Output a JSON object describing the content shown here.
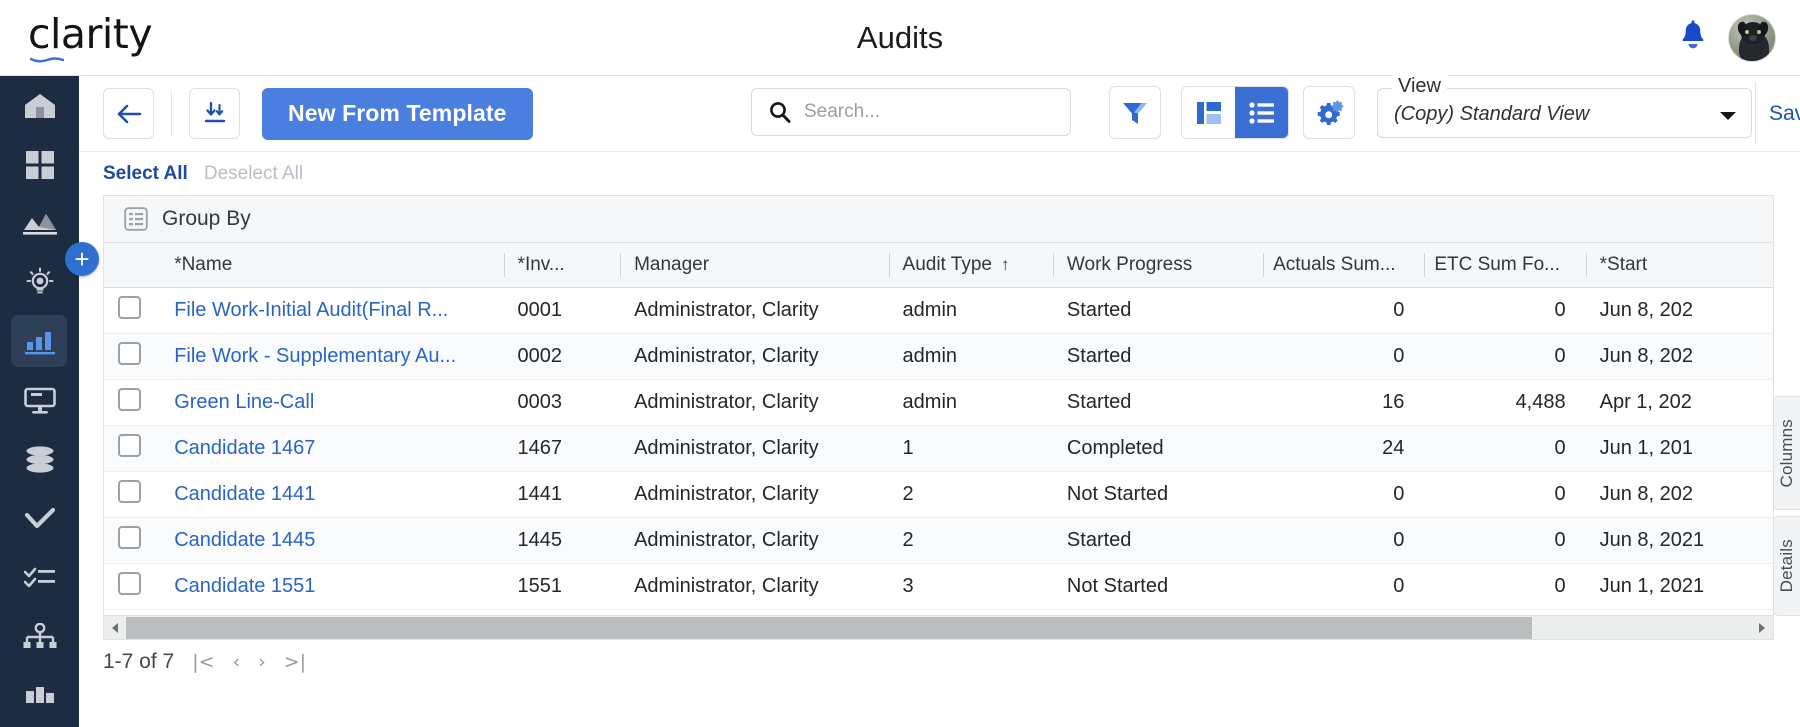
{
  "brand": {
    "name": "clarity"
  },
  "header": {
    "title": "Audits",
    "bell_icon": "notification-bell-icon",
    "avatar_alt": "user-avatar"
  },
  "sidebar": {
    "items": [
      {
        "name": "home",
        "icon": "home-icon",
        "active": false
      },
      {
        "name": "dashboards",
        "icon": "grid-dashboard-icon",
        "active": false
      },
      {
        "name": "analytics",
        "icon": "area-chart-icon",
        "active": false
      },
      {
        "name": "ideas",
        "icon": "lightbulb-icon",
        "active": false
      },
      {
        "name": "reports",
        "icon": "bar-chart-icon",
        "active": true
      },
      {
        "name": "monitor",
        "icon": "monitor-icon",
        "active": false
      },
      {
        "name": "data",
        "icon": "database-icon",
        "active": false
      },
      {
        "name": "approvals",
        "icon": "check-icon",
        "active": false
      },
      {
        "name": "tasks",
        "icon": "checklist-icon",
        "active": false
      },
      {
        "name": "hierarchy",
        "icon": "org-chart-icon",
        "active": false
      },
      {
        "name": "more",
        "icon": "modules-icon",
        "active": false
      }
    ]
  },
  "toolbar": {
    "back_icon": "arrow-left-icon",
    "download_icon": "download-icon",
    "new_from_template_label": "New From Template",
    "search": {
      "value": "",
      "placeholder": "Search..."
    },
    "search_icon": "search-icon",
    "filter_icon": "filter-funnel-icon",
    "board_view_icon": "board-view-icon",
    "list_view_icon": "list-view-icon",
    "list_view_selected": true,
    "settings_icon": "gear-settings-icon",
    "view_label": "View",
    "view_value": "(Copy) Standard View",
    "view_caret_icon": "chevron-down-icon",
    "save_label": "Save"
  },
  "selection": {
    "select_all_label": "Select All",
    "deselect_all_label": "Deselect All"
  },
  "grid": {
    "group_by_label": "Group By",
    "group_by_icon": "group-by-list-icon",
    "add_button_label": "+",
    "columns": [
      {
        "key": "checkbox",
        "label": ""
      },
      {
        "key": "name",
        "label": "*Name"
      },
      {
        "key": "inv",
        "label": "*Inv..."
      },
      {
        "key": "manager",
        "label": "Manager"
      },
      {
        "key": "audit_type",
        "label": "Audit Type",
        "sort": "↑"
      },
      {
        "key": "work_progress",
        "label": "Work Progress"
      },
      {
        "key": "actuals_sum",
        "label": "Actuals Sum..."
      },
      {
        "key": "etc_sum",
        "label": "ETC Sum Fo..."
      },
      {
        "key": "start",
        "label": "*Start"
      }
    ],
    "rows": [
      {
        "name": "File Work-Initial Audit(Final R...",
        "inv": "0001",
        "manager": "Administrator, Clarity",
        "audit_type": "admin",
        "work_progress": "Started",
        "actuals_sum": "0",
        "etc_sum": "0",
        "start": "Jun 8, 202"
      },
      {
        "name": "File Work - Supplementary Au...",
        "inv": "0002",
        "manager": "Administrator, Clarity",
        "audit_type": "admin",
        "work_progress": "Started",
        "actuals_sum": "0",
        "etc_sum": "0",
        "start": "Jun 8, 202"
      },
      {
        "name": "Green Line-Call",
        "inv": "0003",
        "manager": "Administrator, Clarity",
        "audit_type": "admin",
        "work_progress": "Started",
        "actuals_sum": "16",
        "etc_sum": "4,488",
        "start": "Apr 1, 202"
      },
      {
        "name": "Candidate 1467",
        "inv": "1467",
        "manager": "Administrator, Clarity",
        "audit_type": "1",
        "work_progress": "Completed",
        "actuals_sum": "24",
        "etc_sum": "0",
        "start": "Jun 1, 201"
      },
      {
        "name": "Candidate 1441",
        "inv": "1441",
        "manager": "Administrator, Clarity",
        "audit_type": "2",
        "work_progress": "Not Started",
        "actuals_sum": "0",
        "etc_sum": "0",
        "start": "Jun 8, 202"
      },
      {
        "name": "Candidate 1445",
        "inv": "1445",
        "manager": "Administrator, Clarity",
        "audit_type": "2",
        "work_progress": "Started",
        "actuals_sum": "0",
        "etc_sum": "0",
        "start": "Jun 8, 2021"
      },
      {
        "name": "Candidate 1551",
        "inv": "1551",
        "manager": "Administrator, Clarity",
        "audit_type": "3",
        "work_progress": "Not Started",
        "actuals_sum": "0",
        "etc_sum": "0",
        "start": "Jun 1, 2021"
      }
    ]
  },
  "pager": {
    "range_label": "1-7 of 7",
    "first_label": "|<",
    "prev_label": "‹",
    "next_label": "›",
    "last_label": ">|"
  },
  "side_tabs": {
    "columns_label": "Columns",
    "details_label": "Details"
  },
  "colors": {
    "accent_blue": "#4a7fe0",
    "link_blue": "#2a64c4",
    "sidebar_bg": "#1d2c41",
    "active_nav": "#2e4058"
  }
}
